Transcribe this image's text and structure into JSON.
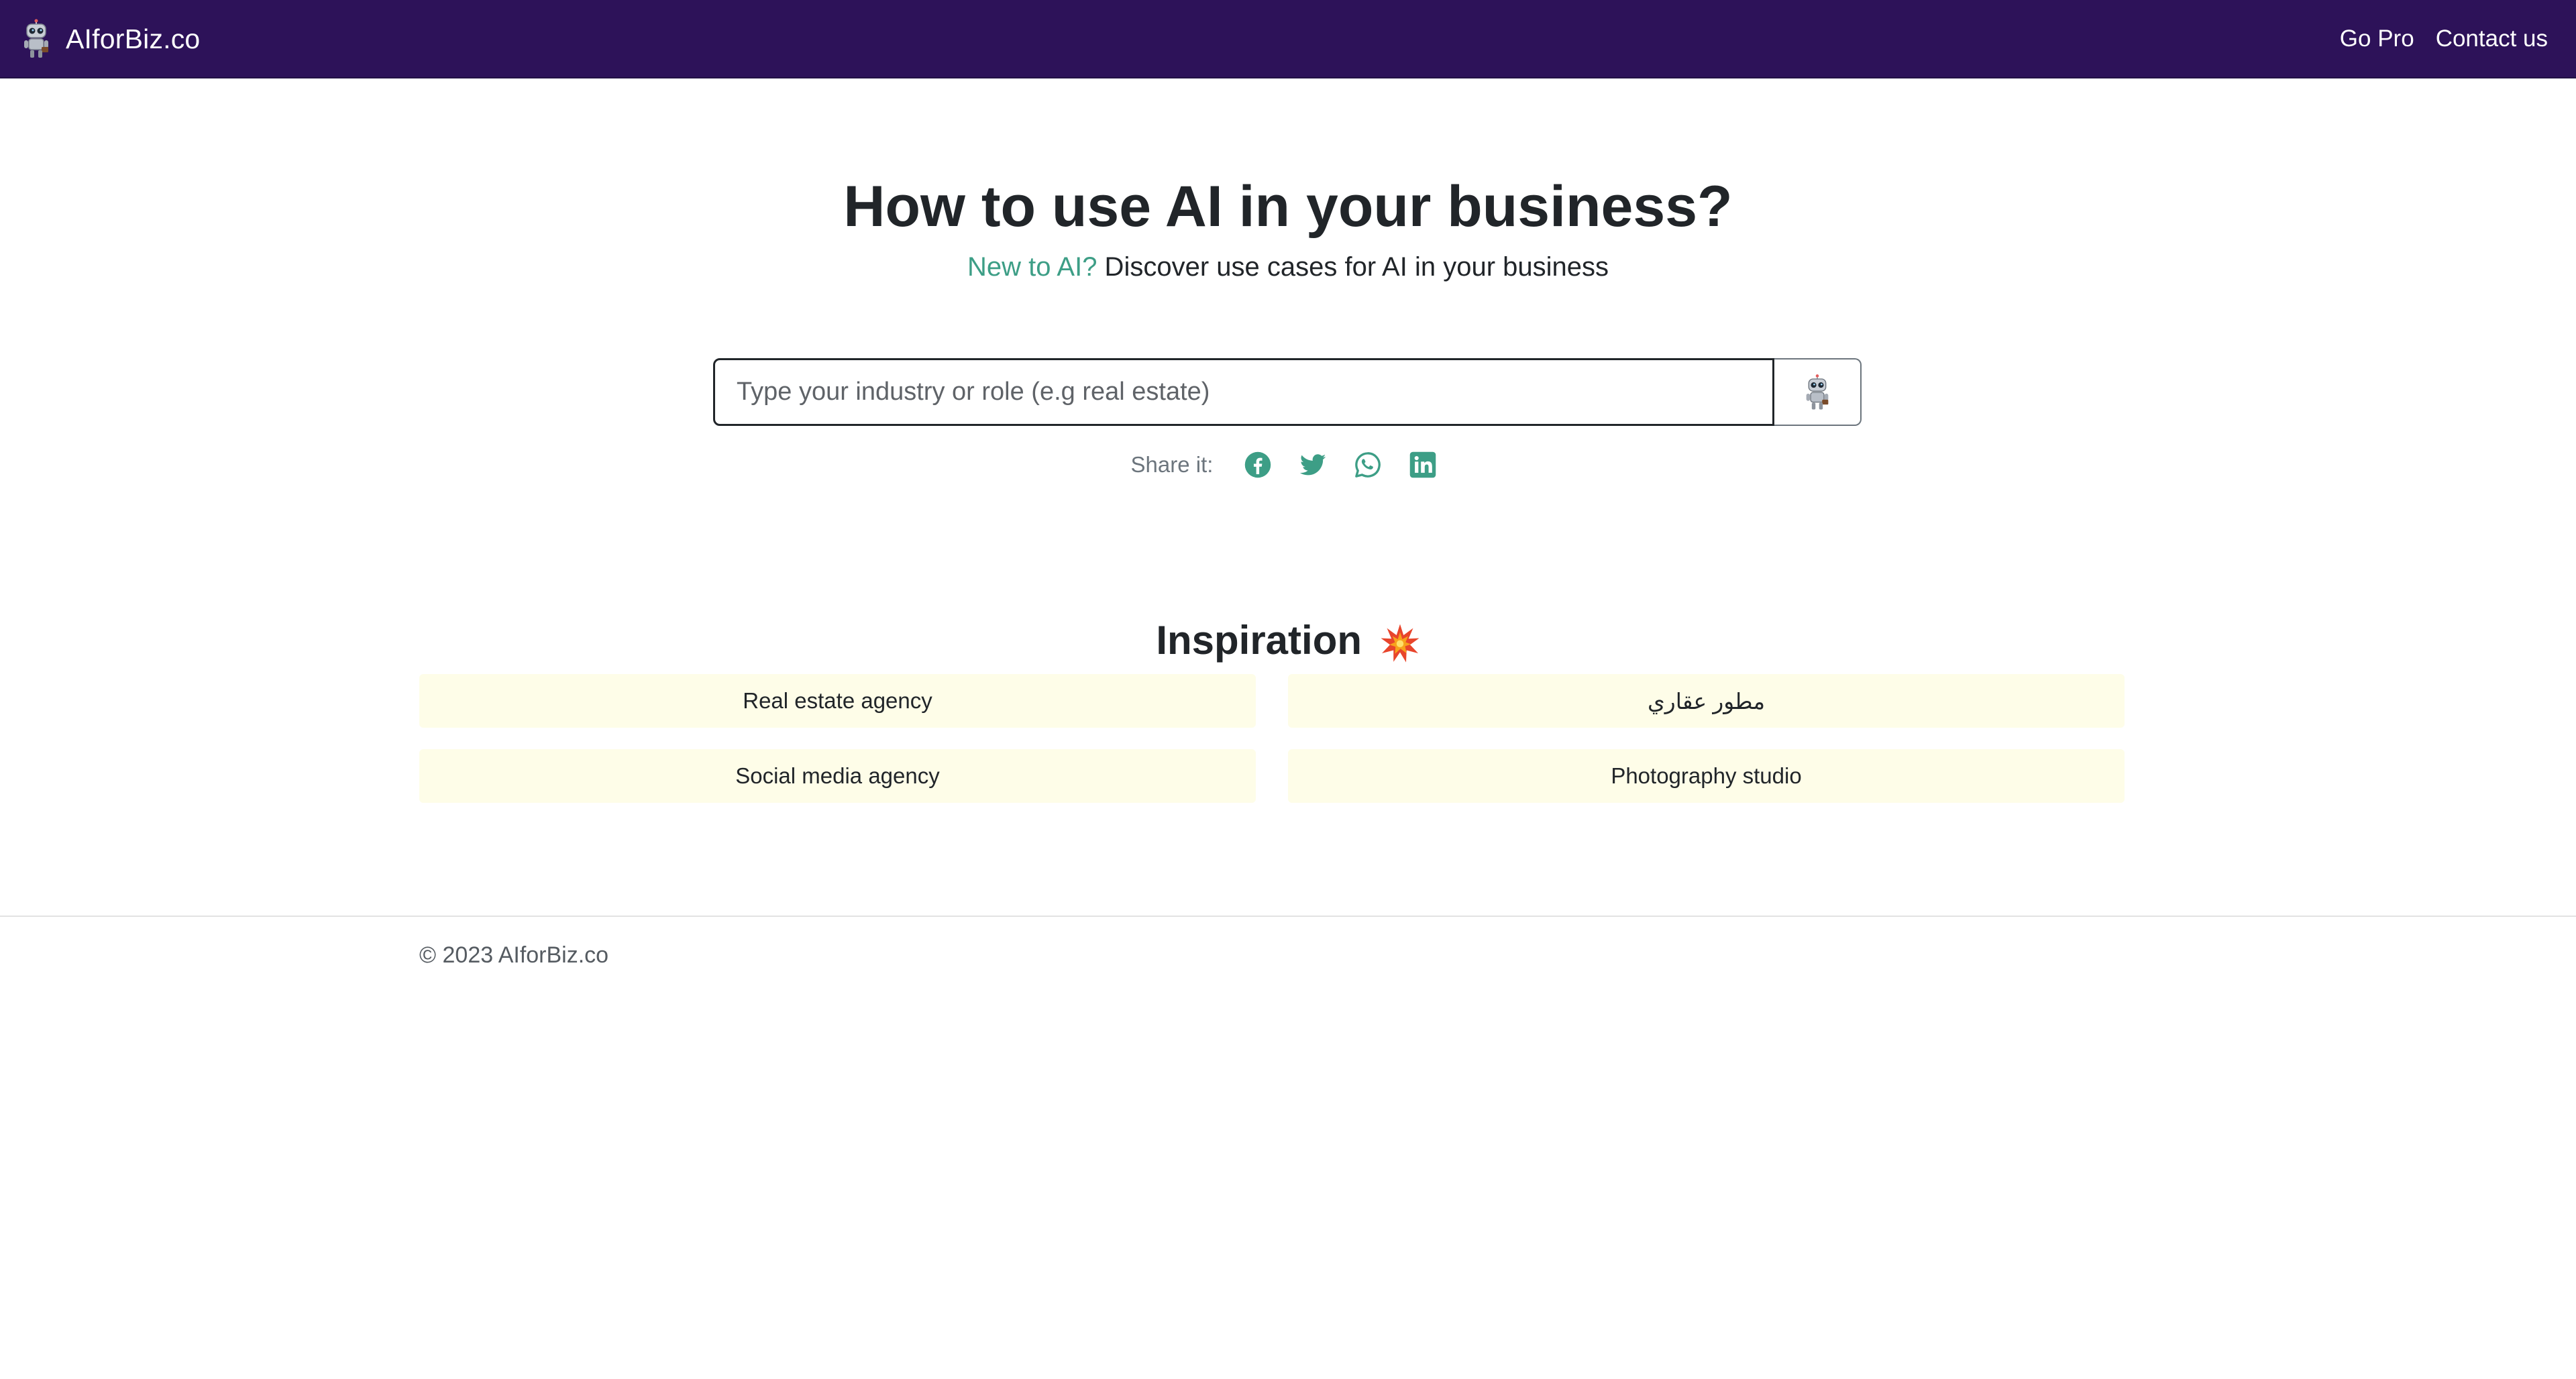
{
  "navbar": {
    "brand_text": "AIforBiz.co",
    "brand_icon": "robot-icon",
    "links": [
      "Go Pro",
      "Contact us"
    ],
    "background_color": "#2d1259"
  },
  "hero": {
    "title": "How to use AI in your business?",
    "subtitle_accent": "New to AI?",
    "subtitle_rest": " Discover use cases for AI in your business",
    "accent_color": "#3d9e86"
  },
  "search": {
    "placeholder": "Type your industry or role (e.g real estate)",
    "value": "",
    "button_icon": "robot-icon"
  },
  "share": {
    "label": "Share it:",
    "icons": [
      "facebook-icon",
      "twitter-icon",
      "whatsapp-icon",
      "linkedin-icon"
    ]
  },
  "inspiration": {
    "title": "Inspiration",
    "title_icon": "collision-icon",
    "items": [
      "Real estate agency",
      "مطور عقاري",
      "Social media agency",
      "Photography studio"
    ],
    "card_color": "#fefde8"
  },
  "footer": {
    "copyright": "© 2023 AIforBiz.co"
  }
}
